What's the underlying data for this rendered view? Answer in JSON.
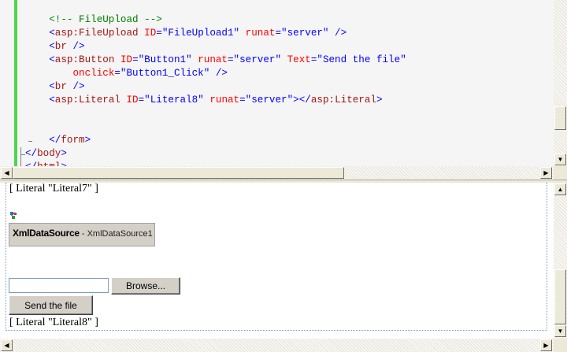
{
  "editor": {
    "lines": [
      [
        {
          "t": "    ",
          "c": ""
        },
        {
          "t": "<!-- FileUpload -->",
          "c": "c-comment"
        }
      ],
      [
        {
          "t": "    ",
          "c": ""
        },
        {
          "t": "<",
          "c": "c-blue"
        },
        {
          "t": "asp:FileUpload",
          "c": "c-tag"
        },
        {
          "t": " ",
          "c": ""
        },
        {
          "t": "ID",
          "c": "c-attr"
        },
        {
          "t": "=\"FileUpload1\"",
          "c": "c-blue"
        },
        {
          "t": " ",
          "c": ""
        },
        {
          "t": "runat",
          "c": "c-attr"
        },
        {
          "t": "=\"server\"",
          "c": "c-blue"
        },
        {
          "t": " />",
          "c": "c-blue"
        }
      ],
      [
        {
          "t": "    ",
          "c": ""
        },
        {
          "t": "<",
          "c": "c-blue"
        },
        {
          "t": "br",
          "c": "c-tag"
        },
        {
          "t": " />",
          "c": "c-blue"
        }
      ],
      [
        {
          "t": "    ",
          "c": ""
        },
        {
          "t": "<",
          "c": "c-blue"
        },
        {
          "t": "asp:Button",
          "c": "c-tag"
        },
        {
          "t": " ",
          "c": ""
        },
        {
          "t": "ID",
          "c": "c-attr"
        },
        {
          "t": "=\"Button1\"",
          "c": "c-blue"
        },
        {
          "t": " ",
          "c": ""
        },
        {
          "t": "runat",
          "c": "c-attr"
        },
        {
          "t": "=\"server\"",
          "c": "c-blue"
        },
        {
          "t": " ",
          "c": ""
        },
        {
          "t": "Text",
          "c": "c-attr"
        },
        {
          "t": "=\"Send the file\"",
          "c": "c-blue"
        }
      ],
      [
        {
          "t": "        ",
          "c": ""
        },
        {
          "t": "onclick",
          "c": "c-attr"
        },
        {
          "t": "=\"Button1_Click\"",
          "c": "c-blue"
        },
        {
          "t": " />",
          "c": "c-blue"
        }
      ],
      [
        {
          "t": "    ",
          "c": ""
        },
        {
          "t": "<",
          "c": "c-blue"
        },
        {
          "t": "br",
          "c": "c-tag"
        },
        {
          "t": " />",
          "c": "c-blue"
        }
      ],
      [
        {
          "t": "    ",
          "c": ""
        },
        {
          "t": "<",
          "c": "c-blue"
        },
        {
          "t": "asp:Literal",
          "c": "c-tag"
        },
        {
          "t": " ",
          "c": ""
        },
        {
          "t": "ID",
          "c": "c-attr"
        },
        {
          "t": "=\"Literal8\"",
          "c": "c-blue"
        },
        {
          "t": " ",
          "c": ""
        },
        {
          "t": "runat",
          "c": "c-attr"
        },
        {
          "t": "=\"server\"",
          "c": "c-blue"
        },
        {
          "t": "></",
          "c": "c-blue"
        },
        {
          "t": "asp:Literal",
          "c": "c-tag"
        },
        {
          "t": ">",
          "c": "c-blue"
        }
      ],
      [],
      [],
      [
        {
          "t": "    ",
          "c": ""
        },
        {
          "t": "</",
          "c": "c-blue"
        },
        {
          "t": "form",
          "c": "c-tag"
        },
        {
          "t": ">",
          "c": "c-blue"
        }
      ],
      [
        {
          "t": "</",
          "c": "c-blue"
        },
        {
          "t": "body",
          "c": "c-tag"
        },
        {
          "t": ">",
          "c": "c-blue"
        }
      ],
      [
        {
          "t": "</",
          "c": "c-blue"
        },
        {
          "t": "html",
          "c": "c-tag"
        },
        {
          "t": ">",
          "c": "c-blue"
        }
      ]
    ]
  },
  "design": {
    "literal7": "[ Literal \"Literal7\" ]",
    "xml_title": "XmlDataSource",
    "xml_sub": " - XmlDataSource1",
    "browse_label": "Browse...",
    "send_label": "Send the file",
    "literal8": "[ Literal \"Literal8\" ]"
  },
  "colors": {
    "change_bar": "#4cd64c",
    "comment": "#008000",
    "keyword": "#0000ff",
    "tag": "#a31515",
    "attribute": "#ff0000"
  }
}
